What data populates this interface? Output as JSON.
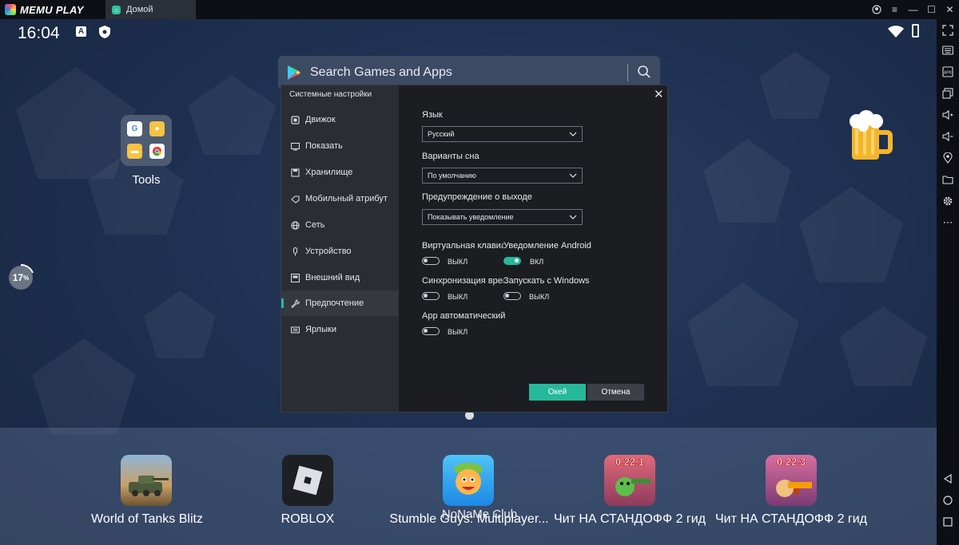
{
  "titlebar": {
    "app_name": "MEMU PLAY",
    "tab_label": "Домой"
  },
  "status": {
    "time": "16:04",
    "badge_letter": "A",
    "download_progress": "17",
    "progress_unit": "%"
  },
  "search": {
    "placeholder": "Search Games and Apps"
  },
  "home": {
    "folder_label": "Tools",
    "dock_apps": [
      {
        "label": "World of Tanks Blitz"
      },
      {
        "label": "ROBLOX"
      },
      {
        "label": "Stumble Guys: Multiplayer..."
      },
      {
        "label": "Чит НА СТАНДОФФ 2 гид",
        "badge": "0.22.1"
      },
      {
        "label": "Чит НА СТАНДОФФ 2 гид",
        "badge": "0.22.3"
      }
    ],
    "watermark": "NoNaMe Club"
  },
  "settings": {
    "title": "Системные настройки",
    "nav": [
      {
        "label": "Движок",
        "icon": "chip-icon"
      },
      {
        "label": "Показать",
        "icon": "monitor-icon"
      },
      {
        "label": "Хранилище",
        "icon": "storage-icon"
      },
      {
        "label": "Мобильный атрибут",
        "icon": "mobile-icon"
      },
      {
        "label": "Сеть",
        "icon": "globe-icon"
      },
      {
        "label": "Устройство",
        "icon": "microphone-icon"
      },
      {
        "label": "Внешний вид",
        "icon": "appearance-icon"
      },
      {
        "label": "Предпочтение",
        "icon": "wrench-icon"
      },
      {
        "label": "Ярлыки",
        "icon": "keyboard-icon"
      }
    ],
    "active_nav": "Предпочтение",
    "language": {
      "label": "Язык",
      "value": "Русский"
    },
    "sleep": {
      "label": "Варианты сна",
      "value": "По умолчанию"
    },
    "exit_warning": {
      "label": "Предупреждение о выходе",
      "value": "Показывать уведомление"
    },
    "toggles": [
      {
        "label": "Виртуальная клавиат",
        "state": "ВЫКЛ",
        "on": false
      },
      {
        "label": "Уведомление Android",
        "state": "ВКЛ",
        "on": true
      },
      {
        "label": "Синхронизация врем",
        "state": "ВЫКЛ",
        "on": false
      },
      {
        "label": "Запускать с Windows",
        "state": "ВЫКЛ",
        "on": false
      },
      {
        "label": "App автоматический",
        "state": "ВЫКЛ",
        "on": false
      }
    ],
    "ok_label": "Окей",
    "cancel_label": "Отмена"
  },
  "colors": {
    "accent": "#26b89a",
    "dialog_bg": "#1b1d21",
    "nav_bg": "#2a2d33"
  }
}
